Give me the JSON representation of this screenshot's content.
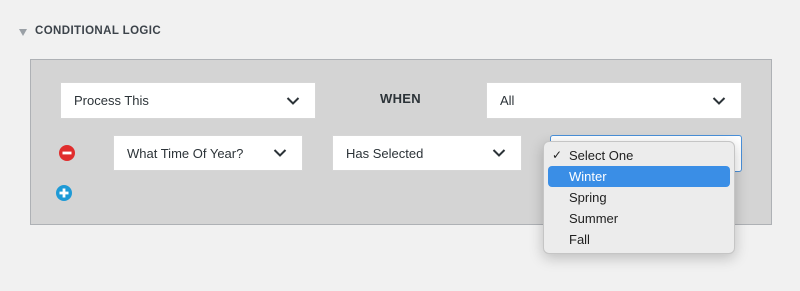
{
  "section": {
    "title": "CONDITIONAL LOGIC"
  },
  "row1": {
    "action_value": "Process This",
    "when_label": "WHEN",
    "match_value": "All"
  },
  "row2": {
    "field_value": "What Time Of Year?",
    "operator_value": "Has Selected",
    "value_options": [
      "Select One",
      "Winter",
      "Spring",
      "Summer",
      "Fall"
    ],
    "checked_option": "Select One",
    "highlighted_option": "Winter"
  },
  "colors": {
    "remove": "#e02d2d",
    "add": "#1e9ad6",
    "highlight": "#3a8ee6",
    "panel": "#d4d4d4"
  }
}
